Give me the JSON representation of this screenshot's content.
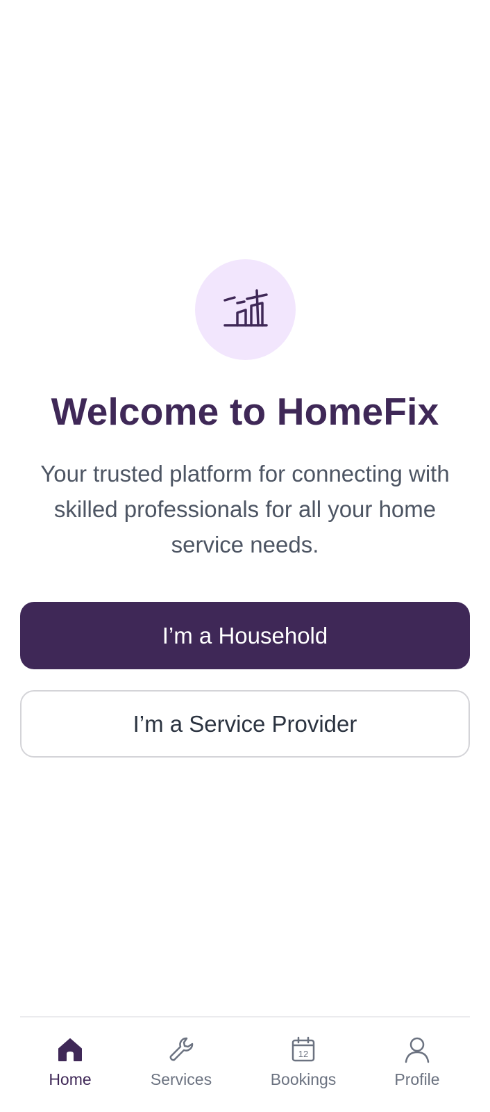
{
  "welcome": {
    "title": "Welcome to HomeFix",
    "subtitle": "Your trusted platform for connecting with skilled professionals for all your home service needs.",
    "logo_icon": "house-build-icon"
  },
  "actions": {
    "household_label": "I’m a Household",
    "provider_label": "I’m a Service Provider"
  },
  "tabbar": {
    "active": "home",
    "tabs": [
      {
        "id": "home",
        "label": "Home",
        "icon": "home-icon"
      },
      {
        "id": "services",
        "label": "Services",
        "icon": "wrench-icon"
      },
      {
        "id": "bookings",
        "label": "Bookings",
        "icon": "calendar-icon",
        "icon_text": "12"
      },
      {
        "id": "profile",
        "label": "Profile",
        "icon": "user-icon"
      }
    ]
  },
  "colors": {
    "brand": "#3f2857",
    "brand_light": "#f2e6fd",
    "text_muted": "#4d5563",
    "tab_inactive": "#6b7280"
  }
}
